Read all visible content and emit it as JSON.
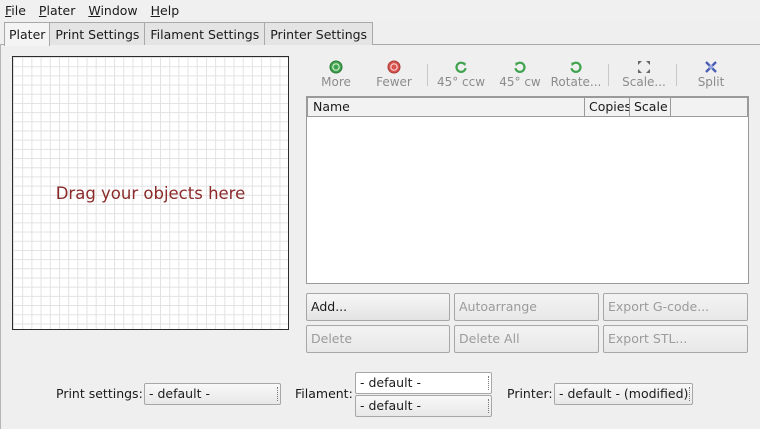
{
  "menubar": {
    "items": [
      {
        "first": "F",
        "rest": "ile"
      },
      {
        "first": "P",
        "rest": "later"
      },
      {
        "first": "W",
        "rest": "indow"
      },
      {
        "first": "H",
        "rest": "elp"
      }
    ]
  },
  "tabs": [
    "Plater",
    "Print Settings",
    "Filament Settings",
    "Printer Settings"
  ],
  "canvas": {
    "placeholder": "Drag your objects here"
  },
  "toolbar": {
    "more": "More",
    "fewer": "Fewer",
    "rotate_ccw": "45° ccw",
    "rotate_cw": "45° cw",
    "rotate": "Rotate...",
    "scale": "Scale...",
    "split": "Split"
  },
  "object_list": {
    "columns": [
      "Name",
      "Copies",
      "Scale"
    ]
  },
  "buttons": {
    "add": "Add...",
    "autoarrange": "Autoarrange",
    "export_gcode": "Export G-code...",
    "delete": "Delete",
    "delete_all": "Delete All",
    "export_stl": "Export STL..."
  },
  "presets": {
    "print_label": "Print settings:",
    "print_value": "- default -",
    "filament_label": "Filament:",
    "filament_values": [
      "- default -",
      "- default -"
    ],
    "printer_label": "Printer:",
    "printer_value": "- default - (modified)"
  },
  "colors": {
    "canvas_text": "#8b2a2a",
    "more_icon": "#3fa34d",
    "fewer_icon": "#d9534f",
    "rotate_icon": "#3fa34d",
    "split_icon": "#4a5fb5"
  }
}
